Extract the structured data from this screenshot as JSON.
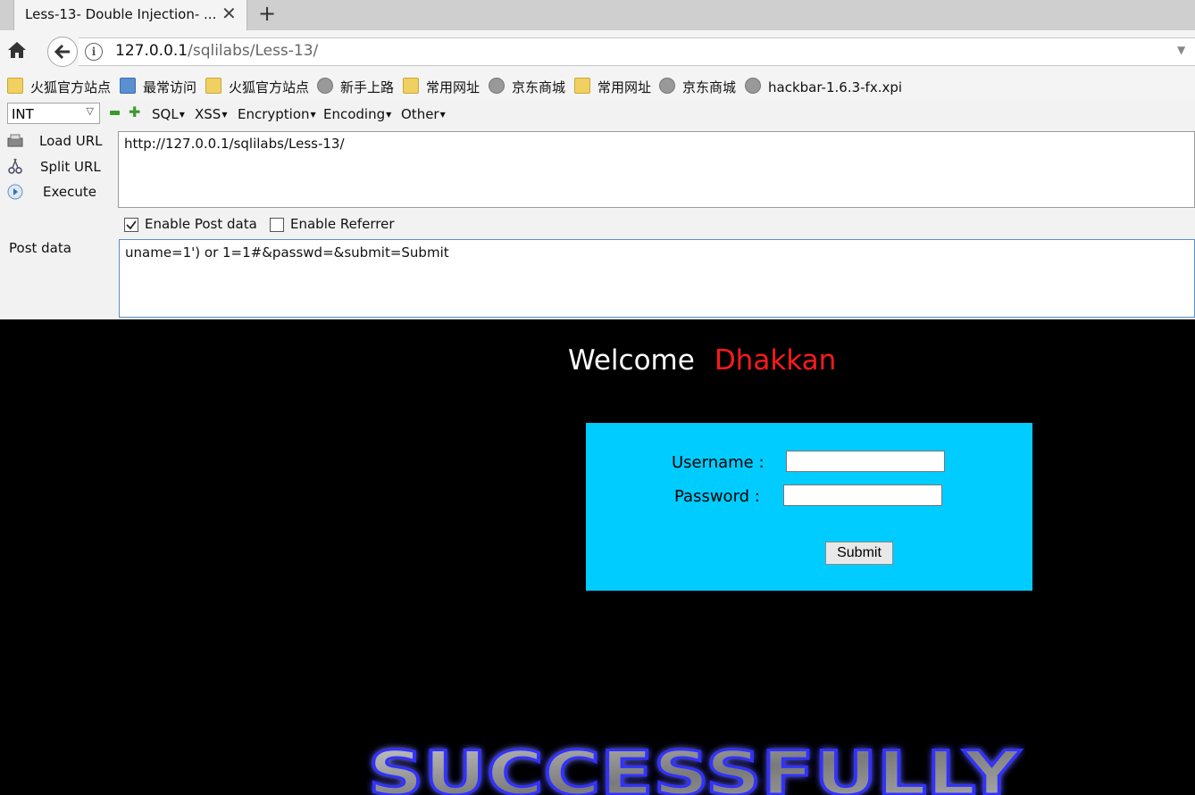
{
  "browser": {
    "tab_title": "Less-13- Double Injection- ...",
    "url_host": "127.0.0.1",
    "url_path": "/sqlilabs/Less-13/"
  },
  "bookmarks": [
    {
      "label": "火狐官方站点",
      "icon": "folder-icon"
    },
    {
      "label": "最常访问",
      "icon": "magnifier-icon"
    },
    {
      "label": "火狐官方站点",
      "icon": "folder-icon"
    },
    {
      "label": "新手上路",
      "icon": "globe-icon"
    },
    {
      "label": "常用网址",
      "icon": "folder-icon"
    },
    {
      "label": "京东商城",
      "icon": "globe-icon"
    },
    {
      "label": "常用网址",
      "icon": "folder-icon"
    },
    {
      "label": "京东商城",
      "icon": "globe-icon"
    },
    {
      "label": "hackbar-1.6.3-fx.xpi",
      "icon": "globe-icon"
    }
  ],
  "hackbar": {
    "type_select": "INT",
    "menus": [
      "SQL",
      "XSS",
      "Encryption",
      "Encoding",
      "Other"
    ],
    "load_url": "Load URL",
    "split_url": "Split URL",
    "execute": "Execute",
    "url_value": "http://127.0.0.1/sqlilabs/Less-13/",
    "enable_post": {
      "label": "Enable Post data",
      "checked": true
    },
    "enable_referrer": {
      "label": "Enable Referrer",
      "checked": false
    },
    "post_label": "Post data",
    "post_value": "uname=1') or 1=1#&passwd=&submit=Submit"
  },
  "page": {
    "welcome": "Welcome",
    "name": "Dhakkan",
    "username_label": "Username :",
    "password_label": "Password :",
    "submit_label": "Submit",
    "banner_text": "SUCCESSFULLY"
  },
  "colors": {
    "login_box": "#00ccff",
    "name_red": "#ff1a1a",
    "banner_glow": "#3030ff"
  }
}
